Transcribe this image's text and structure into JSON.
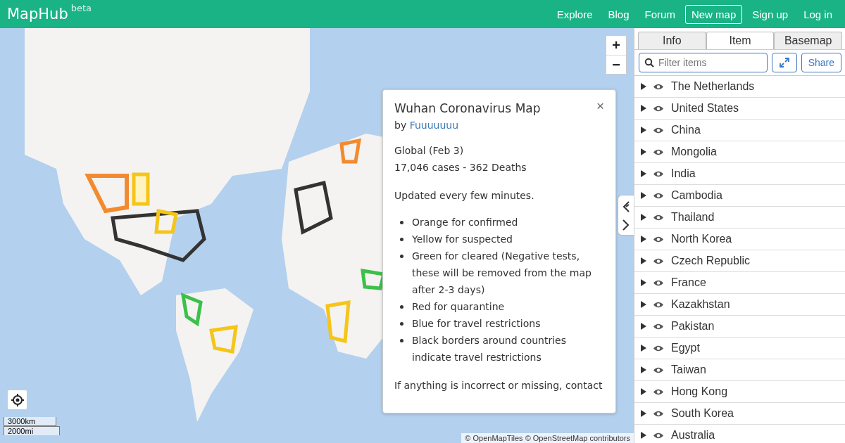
{
  "header": {
    "brand": "MapHub",
    "badge": "beta",
    "nav": [
      {
        "label": "Explore",
        "kind": "link"
      },
      {
        "label": "Blog",
        "kind": "link"
      },
      {
        "label": "Forum",
        "kind": "link"
      },
      {
        "label": "New map",
        "kind": "outlined"
      },
      {
        "label": "Sign up",
        "kind": "link"
      },
      {
        "label": "Log in",
        "kind": "link"
      }
    ]
  },
  "map": {
    "zoom_in": "+",
    "zoom_out": "−",
    "scale": [
      "3000km",
      "2000mi"
    ],
    "attribution": "© OpenMapTiles © OpenStreetMap contributors"
  },
  "popup": {
    "title": "Wuhan Coronavirus Map",
    "by": "by",
    "author": "Fuuuuuuu",
    "close": "×",
    "lines": [
      "Global (Feb 3)",
      "17,046 cases - 362 Deaths"
    ],
    "updated": "Updated every few minutes.",
    "legend": [
      "Orange for confirmed",
      "Yellow for suspected",
      "Green for cleared (Negative tests, these will be removed from the map after 2-3 days)",
      "Red for quarantine",
      "Blue for travel restrictions",
      "Black borders around countries indicate travel restrictions"
    ],
    "footer": "If anything is incorrect or missing, contact"
  },
  "sidebar": {
    "tabs": [
      {
        "label": "Info",
        "selected": false
      },
      {
        "label": "Item",
        "selected": true
      },
      {
        "label": "Basemap",
        "selected": false
      }
    ],
    "filter": {
      "placeholder": "Filter items"
    },
    "share": "Share",
    "items": [
      {
        "name": "The Netherlands",
        "expanded": false,
        "visible": true
      },
      {
        "name": "United States",
        "expanded": false,
        "visible": true
      },
      {
        "name": "China",
        "expanded": false,
        "visible": true
      },
      {
        "name": "Mongolia",
        "expanded": false,
        "visible": true
      },
      {
        "name": "India",
        "expanded": false,
        "visible": true
      },
      {
        "name": "Cambodia",
        "expanded": false,
        "visible": true
      },
      {
        "name": "Thailand",
        "expanded": false,
        "visible": true
      },
      {
        "name": "North Korea",
        "expanded": false,
        "visible": true
      },
      {
        "name": "Czech Republic",
        "expanded": false,
        "visible": true
      },
      {
        "name": "France",
        "expanded": false,
        "visible": true
      },
      {
        "name": "Kazakhstan",
        "expanded": false,
        "visible": true
      },
      {
        "name": "Pakistan",
        "expanded": false,
        "visible": true
      },
      {
        "name": "Egypt",
        "expanded": false,
        "visible": true
      },
      {
        "name": "Taiwan",
        "expanded": false,
        "visible": true
      },
      {
        "name": "Hong Kong",
        "expanded": false,
        "visible": true
      },
      {
        "name": "South Korea",
        "expanded": false,
        "visible": true
      },
      {
        "name": "Australia",
        "expanded": false,
        "visible": true
      }
    ]
  }
}
